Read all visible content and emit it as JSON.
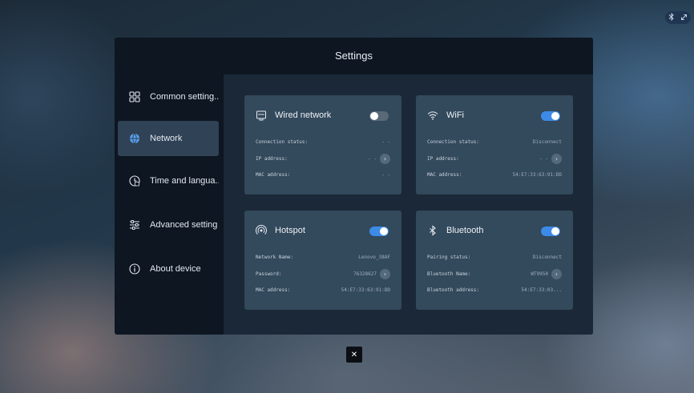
{
  "tray": {
    "bluetooth_icon": "bluetooth-icon",
    "link_icon": "link-icon"
  },
  "dialog": {
    "title": "Settings",
    "close_icon": "close-icon"
  },
  "sidebar": {
    "items": [
      {
        "label": "Common setting..",
        "icon": "grid-icon"
      },
      {
        "label": "Network",
        "icon": "globe-icon",
        "active": true
      },
      {
        "label": "Time and langua..",
        "icon": "clock-language-icon"
      },
      {
        "label": "Advanced setting",
        "icon": "sliders-icon"
      },
      {
        "label": "About device",
        "icon": "info-icon"
      }
    ]
  },
  "cards": {
    "wired": {
      "title": "Wired network",
      "icon": "ethernet-icon",
      "toggle": "off",
      "rows": [
        {
          "label": "Connection status:",
          "value": "- -"
        },
        {
          "label": "IP address:",
          "value": "- -"
        },
        {
          "label": "MAC address:",
          "value": "- -"
        }
      ]
    },
    "wifi": {
      "title": "WiFi",
      "icon": "wifi-icon",
      "toggle": "on",
      "rows": [
        {
          "label": "Connection status:",
          "value": "Disconnect"
        },
        {
          "label": "IP address:",
          "value": "- -"
        },
        {
          "label": "MAC address:",
          "value": "54:E7:33:63:91:DD"
        }
      ]
    },
    "hotspot": {
      "title": "Hotspot",
      "icon": "hotspot-icon",
      "toggle": "on",
      "rows": [
        {
          "label": "Network Name:",
          "value": "Lenovo_38AF"
        },
        {
          "label": "Password:",
          "value": "76328627"
        },
        {
          "label": "MAC address:",
          "value": "54:E7:33:63:91:DD"
        }
      ]
    },
    "bluetooth": {
      "title": "Bluetooth",
      "icon": "bluetooth-icon",
      "toggle": "on",
      "rows": [
        {
          "label": "Pairing status:",
          "value": "Disconnect"
        },
        {
          "label": "Bluetooth Name:",
          "value": "WT9950"
        },
        {
          "label": "Bluetooth address:",
          "value": "54:E7:33:03..."
        }
      ]
    }
  },
  "colors": {
    "accent": "#3d8be8",
    "dialog_bg": "#0d1621",
    "card_bg": "#33495c",
    "active_item": "#2f4256"
  }
}
